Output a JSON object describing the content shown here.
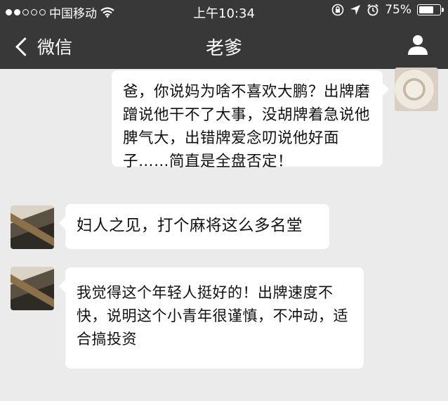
{
  "status_bar": {
    "carrier": "中国移动",
    "time": "上午10:34",
    "battery": "75%",
    "battery_level": 0.75,
    "signal_bars_filled": 2,
    "signal_bars_total": 5
  },
  "nav": {
    "back_label": "微信",
    "title": "老爹"
  },
  "messages": [
    {
      "side": "right",
      "sender": "self",
      "text": "爸，你说妈为啥不喜欢大鹏？出牌磨蹭说他干不了大事，没胡牌着急说他脾气大，出错牌爱念叨说他好面子……简直是全盘否定！"
    },
    {
      "side": "left",
      "sender": "dad",
      "text": "妇人之见，打个麻将这么多名堂"
    },
    {
      "side": "left",
      "sender": "dad",
      "text": "我觉得这个年轻人挺好的！出牌速度不快，说明这个小青年很谨慎，不冲动，适合搞投资"
    }
  ],
  "colors": {
    "nav_background": "#383838",
    "chat_background": "#ebebeb",
    "bubble_background": "#ffffff",
    "text": "#111111"
  }
}
